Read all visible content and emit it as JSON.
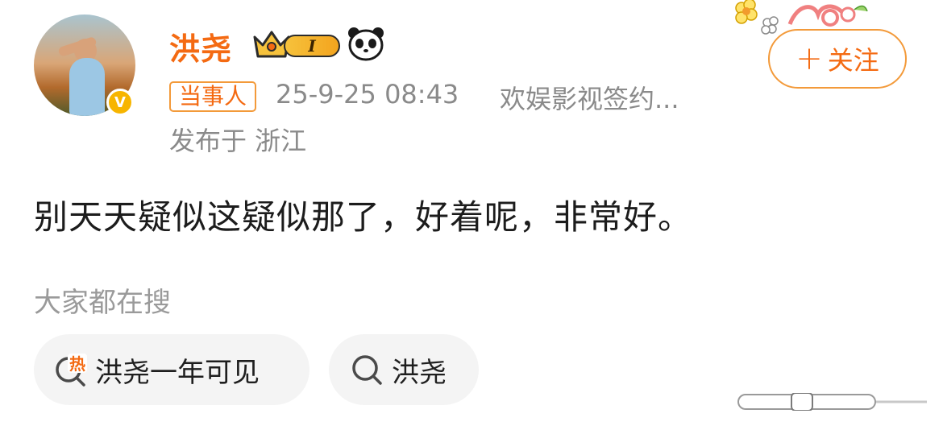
{
  "post": {
    "username": "洪尧",
    "level": "I",
    "tag": "当事人",
    "time": "25-9-25 08:43",
    "source": "欢娱影视签约...",
    "location": "发布于 浙江",
    "content": "别天天疑似这疑似那了，好着呢，非常好。"
  },
  "follow_button": {
    "plus": "+",
    "label": "关注"
  },
  "trending": {
    "title": "大家都在搜",
    "items": [
      {
        "label": "洪尧一年可见",
        "icon": "hot-search-icon",
        "badge": "热"
      },
      {
        "label": "洪尧",
        "icon": "search-icon"
      }
    ]
  },
  "badges": {
    "verified": "V"
  },
  "colors": {
    "accent": "#f46a12",
    "accent_border": "#f39a3a",
    "meta_text": "#8a8a8a",
    "chip_bg": "#f4f4f4"
  }
}
